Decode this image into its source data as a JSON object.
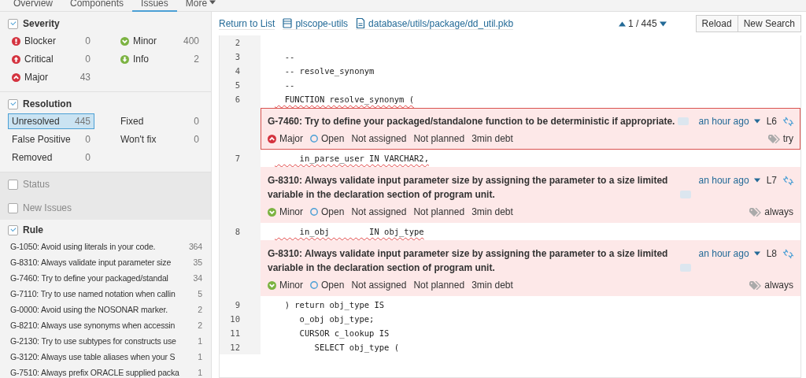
{
  "nav_tabs": [
    {
      "label": "Overview",
      "selected": false
    },
    {
      "label": "Components",
      "selected": false
    },
    {
      "label": "Issues",
      "selected": true
    },
    {
      "label": "More",
      "selected": false,
      "dropdown": true
    }
  ],
  "sidebar": {
    "facets": [
      {
        "title": "Severity",
        "checked": true,
        "kind": "grid",
        "items": [
          {
            "label": "Blocker",
            "count": "0",
            "kind": "blocker",
            "selected": false
          },
          {
            "label": "Minor",
            "count": "400",
            "kind": "minor",
            "selected": false
          },
          {
            "label": "Critical",
            "count": "0",
            "kind": "critical",
            "selected": false
          },
          {
            "label": "Info",
            "count": "2",
            "kind": "info",
            "selected": false
          },
          {
            "label": "Major",
            "count": "43",
            "kind": "major",
            "selected": false
          }
        ]
      },
      {
        "title": "Resolution",
        "checked": true,
        "kind": "grid",
        "items": [
          {
            "label": "Unresolved",
            "count": "445",
            "selected": true
          },
          {
            "label": "Fixed",
            "count": "0",
            "selected": false
          },
          {
            "label": "False Positive",
            "count": "0",
            "selected": false
          },
          {
            "label": "Won't fix",
            "count": "0",
            "selected": false
          },
          {
            "label": "Removed",
            "count": "0",
            "selected": false
          }
        ]
      },
      {
        "title": "Status",
        "checked": false,
        "kind": "collapsed"
      },
      {
        "title": "New Issues",
        "checked": false,
        "kind": "collapsed"
      },
      {
        "title": "Rule",
        "checked": true,
        "kind": "list",
        "items": [
          {
            "label": "G-1050: Avoid using literals in your code.",
            "count": "364",
            "selected": false
          },
          {
            "label": "G-8310: Always validate input parameter size",
            "count": "35",
            "selected": false
          },
          {
            "label": "G-7460: Try to define your packaged/standal",
            "count": "34",
            "selected": false
          },
          {
            "label": "G-7110: Try to use named notation when callin",
            "count": "5",
            "selected": false
          },
          {
            "label": "G-0000: Avoid using the NOSONAR marker.",
            "count": "2",
            "selected": false
          },
          {
            "label": "G-8210: Always use synonyms when accessin",
            "count": "2",
            "selected": false
          },
          {
            "label": "G-2130: Try to use subtypes for constructs use",
            "count": "1",
            "selected": false
          },
          {
            "label": "G-3120: Always use table aliases when your S",
            "count": "1",
            "selected": false
          },
          {
            "label": "G-7510: Always prefix ORACLE supplied packa",
            "count": "1",
            "selected": false
          }
        ]
      }
    ]
  },
  "header": {
    "return_link": "Return to List",
    "project": "plscope-utils",
    "file": "database/utils/package/dd_util.pkb",
    "position": "1 / 445",
    "buttons": [
      "Reload",
      "New Search"
    ]
  },
  "source": [
    {
      "kind": "line",
      "number": "2"
    },
    {
      "kind": "line",
      "number": "3",
      "text": "  --"
    },
    {
      "kind": "line",
      "number": "4",
      "text": "  -- resolve_synonym"
    },
    {
      "kind": "line",
      "number": "5",
      "text": "  --"
    },
    {
      "kind": "line",
      "number": "6",
      "text": "  FUNCTION resolve_synonym (",
      "underlined": true
    },
    {
      "kind": "issue",
      "message": "G-7460: Try to define your packaged/standalone function to be deterministic if appropriate.",
      "selected": true,
      "severity": {
        "kind": "major",
        "label": "Major"
      },
      "status": "Open",
      "assignee": "Not assigned",
      "plan": "Not planned",
      "debt": "3min debt",
      "time": "an hour ago",
      "line": "L6",
      "tag": "try"
    },
    {
      "kind": "line",
      "number": "7",
      "text": "     in_parse_user IN VARCHAR2,",
      "underlined": true
    },
    {
      "kind": "issue",
      "message": "G-8310: Always validate input parameter size by assigning the parameter to a size limited variable in the declaration section of program unit.",
      "selected": false,
      "severity": {
        "kind": "minor",
        "label": "Minor"
      },
      "status": "Open",
      "assignee": "Not assigned",
      "plan": "Not planned",
      "debt": "3min debt",
      "time": "an hour ago",
      "line": "L7",
      "tag": "always"
    },
    {
      "kind": "line",
      "number": "8",
      "text": "     in_obj        IN obj_type",
      "underlined": true
    },
    {
      "kind": "issue",
      "message": "G-8310: Always validate input parameter size by assigning the parameter to a size limited variable in the declaration section of program unit.",
      "selected": false,
      "severity": {
        "kind": "minor",
        "label": "Minor"
      },
      "status": "Open",
      "assignee": "Not assigned",
      "plan": "Not planned",
      "debt": "3min debt",
      "time": "an hour ago",
      "line": "L8",
      "tag": "always"
    },
    {
      "kind": "line",
      "number": "9",
      "text": "  ) return obj_type IS"
    },
    {
      "kind": "line",
      "number": "10",
      "text": "     o_obj obj_type;"
    },
    {
      "kind": "line",
      "number": "11",
      "text": "     CURSOR c_lookup IS"
    },
    {
      "kind": "line",
      "number": "12",
      "text": "        SELECT obj_type ("
    }
  ]
}
